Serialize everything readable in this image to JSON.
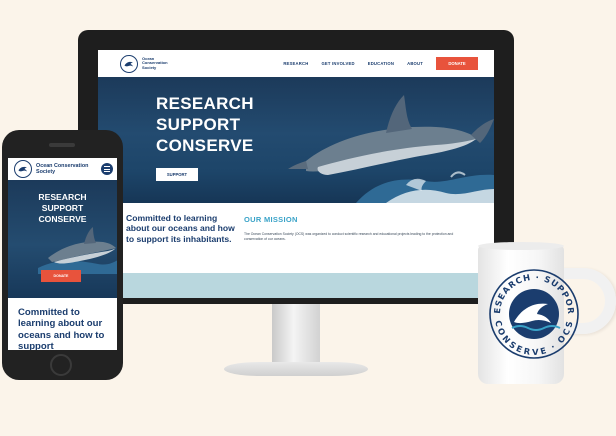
{
  "colors": {
    "navy": "#1b3d6e",
    "accent_orange": "#e8533c",
    "mission_blue": "#3aa3c8",
    "band_light_blue": "#b9d7de",
    "background": "#fbf4ea"
  },
  "brand": {
    "name_line1": "Ocean",
    "name_line2": "Conservation",
    "name_line3": "Society",
    "mobile_name": "Ocean Conservation Society",
    "logo_icon": "dolphin-logo-icon"
  },
  "desktop": {
    "nav": {
      "links": [
        "RESEARCH",
        "GET INVOLVED",
        "EDUCATION",
        "ABOUT"
      ],
      "donate_label": "DONATE"
    },
    "hero": {
      "title_lines": [
        "RESEARCH",
        "SUPPORT",
        "CONSERVE"
      ],
      "cta_label": "SUPPORT"
    },
    "tagline": "Committed to learning about our oceans and how to support its inhabitants.",
    "mission": {
      "heading": "OUR MISSION",
      "body": "The Ocean Conservation Society (OCS) was organized to conduct scientific research and educational projects leading to the protection and conservation of our oceans."
    }
  },
  "mobile": {
    "hero": {
      "title_lines": [
        "RESEARCH",
        "SUPPORT",
        "CONSERVE"
      ],
      "cta_label": "DONATE"
    },
    "tagline": "Committed to learning about our oceans and how to support"
  },
  "mug": {
    "ring_top": "RESEARCH · SUPPORT",
    "ring_bottom": "CONSERVE · OCS"
  }
}
